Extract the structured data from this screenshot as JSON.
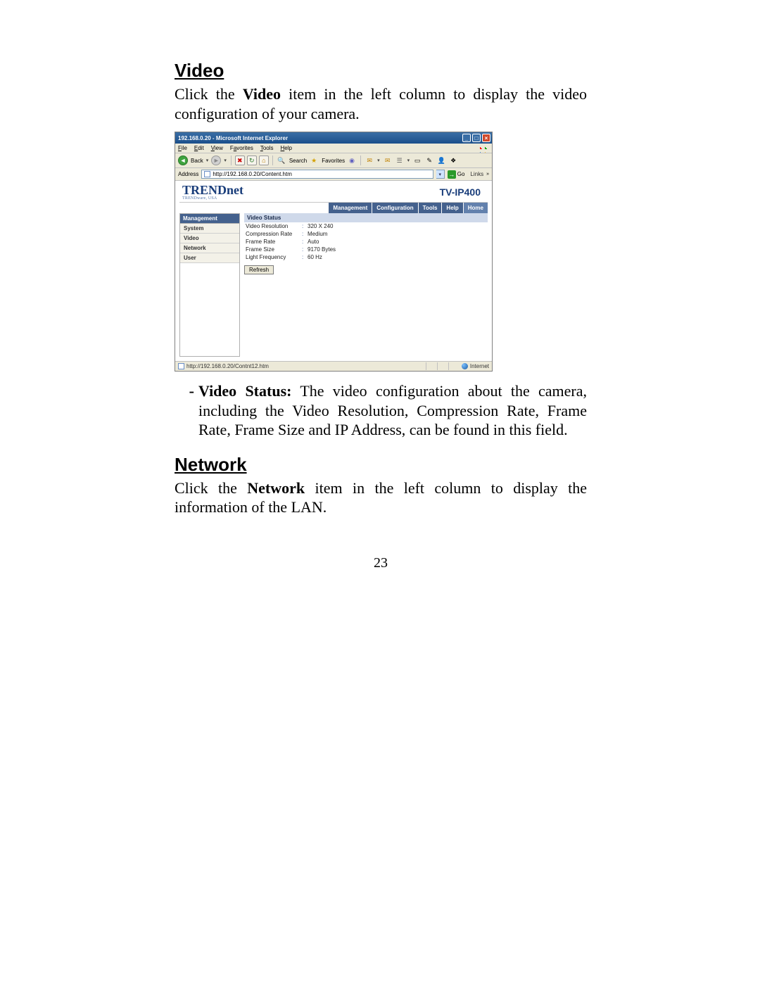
{
  "section1": {
    "heading": "Video",
    "intro_before": "Click the ",
    "intro_bold": "Video",
    "intro_after": " item in the left column to display the video configuration of your camera."
  },
  "browser": {
    "title": "192.168.0.20 - Microsoft Internet Explorer",
    "menus": {
      "file": "File",
      "edit": "Edit",
      "view": "View",
      "favorites": "Favorites",
      "tools": "Tools",
      "help": "Help"
    },
    "toolbar": {
      "back": "Back",
      "search": "Search",
      "favorites": "Favorites"
    },
    "address_label": "Address",
    "url": "http://192.168.0.20/Content.htm",
    "go": "Go",
    "links": "Links",
    "brand": "TRENDnet",
    "brand_sub": "TRENDware, USA",
    "brand_right": "TV-IP400",
    "tabs": {
      "management": "Management",
      "configuration": "Configuration",
      "tools": "Tools",
      "help": "Help",
      "home": "Home"
    },
    "side_header": "Management",
    "side_items": [
      "System",
      "Video",
      "Network",
      "User"
    ],
    "block_header": "Video Status",
    "rows": [
      {
        "k": "Video Resolution",
        "v": "320 X 240"
      },
      {
        "k": "Compression Rate",
        "v": "Medium"
      },
      {
        "k": "Frame Rate",
        "v": "Auto"
      },
      {
        "k": "Frame Size",
        "v": "9170 Bytes"
      },
      {
        "k": "Light Frequency",
        "v": "60 Hz"
      }
    ],
    "refresh": "Refresh",
    "status_url": "http://192.168.0.20/Contnt12.htm",
    "status_zone": "Internet"
  },
  "bullet": {
    "lead": "Video Status:",
    "text": " The video configuration about the camera, including the Video Resolution, Compression Rate, Frame Rate, Frame Size and IP Address, can be found in this field."
  },
  "section2": {
    "heading": "Network",
    "intro_before": "Click the ",
    "intro_bold": "Network",
    "intro_after": " item in the left column to display the information of the LAN."
  },
  "page_number": "23"
}
